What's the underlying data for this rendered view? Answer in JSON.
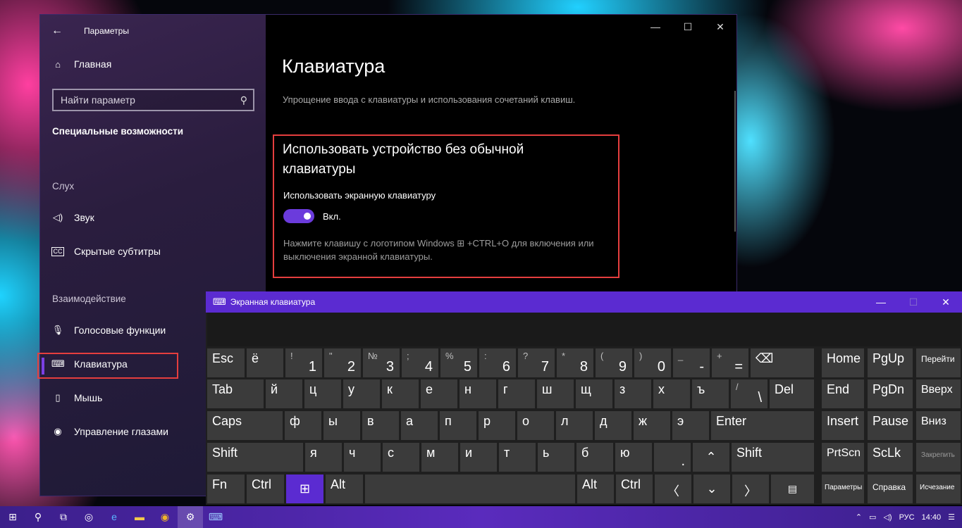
{
  "settings": {
    "app_title": "Параметры",
    "home_label": "Главная",
    "search_placeholder": "Найти параметр",
    "section_title": "Специальные возможности",
    "group_hearing": "Слух",
    "group_interaction": "Взаимодействие",
    "nav": {
      "sound": "Звук",
      "captions": "Скрытые субтитры",
      "speech": "Голосовые функции",
      "keyboard": "Клавиатура",
      "mouse": "Мышь",
      "eye_control": "Управление глазами"
    },
    "page_title": "Клавиатура",
    "page_description": "Упрощение ввода с клавиатуры и использования сочетаний клавиш.",
    "subheading": "Использовать устройство без обычной клавиатуры",
    "toggle_label": "Использовать экранную клавиатуру",
    "toggle_state": "Вкл.",
    "hint": "Нажмите клавишу с логотипом Windows ⊞ +CTRL+O для включения или выключения экранной клавиатуры."
  },
  "osk": {
    "title": "Экранная клавиатура",
    "keys": {
      "esc": "Esc",
      "yo": "ё",
      "k1s": "!",
      "k1": "1",
      "k2s": "\"",
      "k2": "2",
      "k3s": "№",
      "k3": "3",
      "k4s": ";",
      "k4": "4",
      "k5s": "%",
      "k5": "5",
      "k6s": ":",
      "k6": "6",
      "k7s": "?",
      "k7": "7",
      "k8s": "*",
      "k8": "8",
      "k9s": "(",
      "k9": "9",
      "k0s": ")",
      "k0": "0",
      "minus_s": "_",
      "minus": "-",
      "eq_s": "+",
      "eq": "=",
      "backspace": "⌫",
      "tab": "Tab",
      "y": "й",
      "ts": "ц",
      "u": "у",
      "k": "к",
      "e": "е",
      "n": "н",
      "g": "г",
      "sh": "ш",
      "sch": "щ",
      "z": "з",
      "h": "х",
      "hard": "ъ",
      "slash_s": "/",
      "backslash": "\\",
      "del": "Del",
      "caps": "Caps",
      "f": "ф",
      "yy": "ы",
      "v": "в",
      "a": "а",
      "p": "п",
      "r": "р",
      "o": "о",
      "l": "л",
      "d": "д",
      "zh": "ж",
      "ee": "э",
      "enter": "Enter",
      "shift": "Shift",
      "ya": "я",
      "ch": "ч",
      "s": "с",
      "m": "м",
      "i": "и",
      "t": "т",
      "soft": "ь",
      "b": "б",
      "yu": "ю",
      "dot": ".",
      "up": "⌃",
      "rshift": "Shift",
      "fn": "Fn",
      "ctrl": "Ctrl",
      "win": "⊞",
      "alt": "Alt",
      "ralt": "Alt",
      "rctrl": "Ctrl",
      "left": "〈",
      "down": "⌄",
      "right": "〉",
      "menu": "▤",
      "home": "Home",
      "pgup": "PgUp",
      "goto": "Перейти",
      "end": "End",
      "pgdn": "PgDn",
      "moveup": "Вверх",
      "insert": "Insert",
      "pause": "Pause",
      "movedown": "Вниз",
      "prtscn": "PrtScn",
      "sclk": "ScLk",
      "dock": "Закрепить",
      "options": "Параметры",
      "help": "Справка",
      "fade": "Исчезание"
    }
  },
  "taskbar": {
    "language": "РУС",
    "time": "14:40"
  }
}
